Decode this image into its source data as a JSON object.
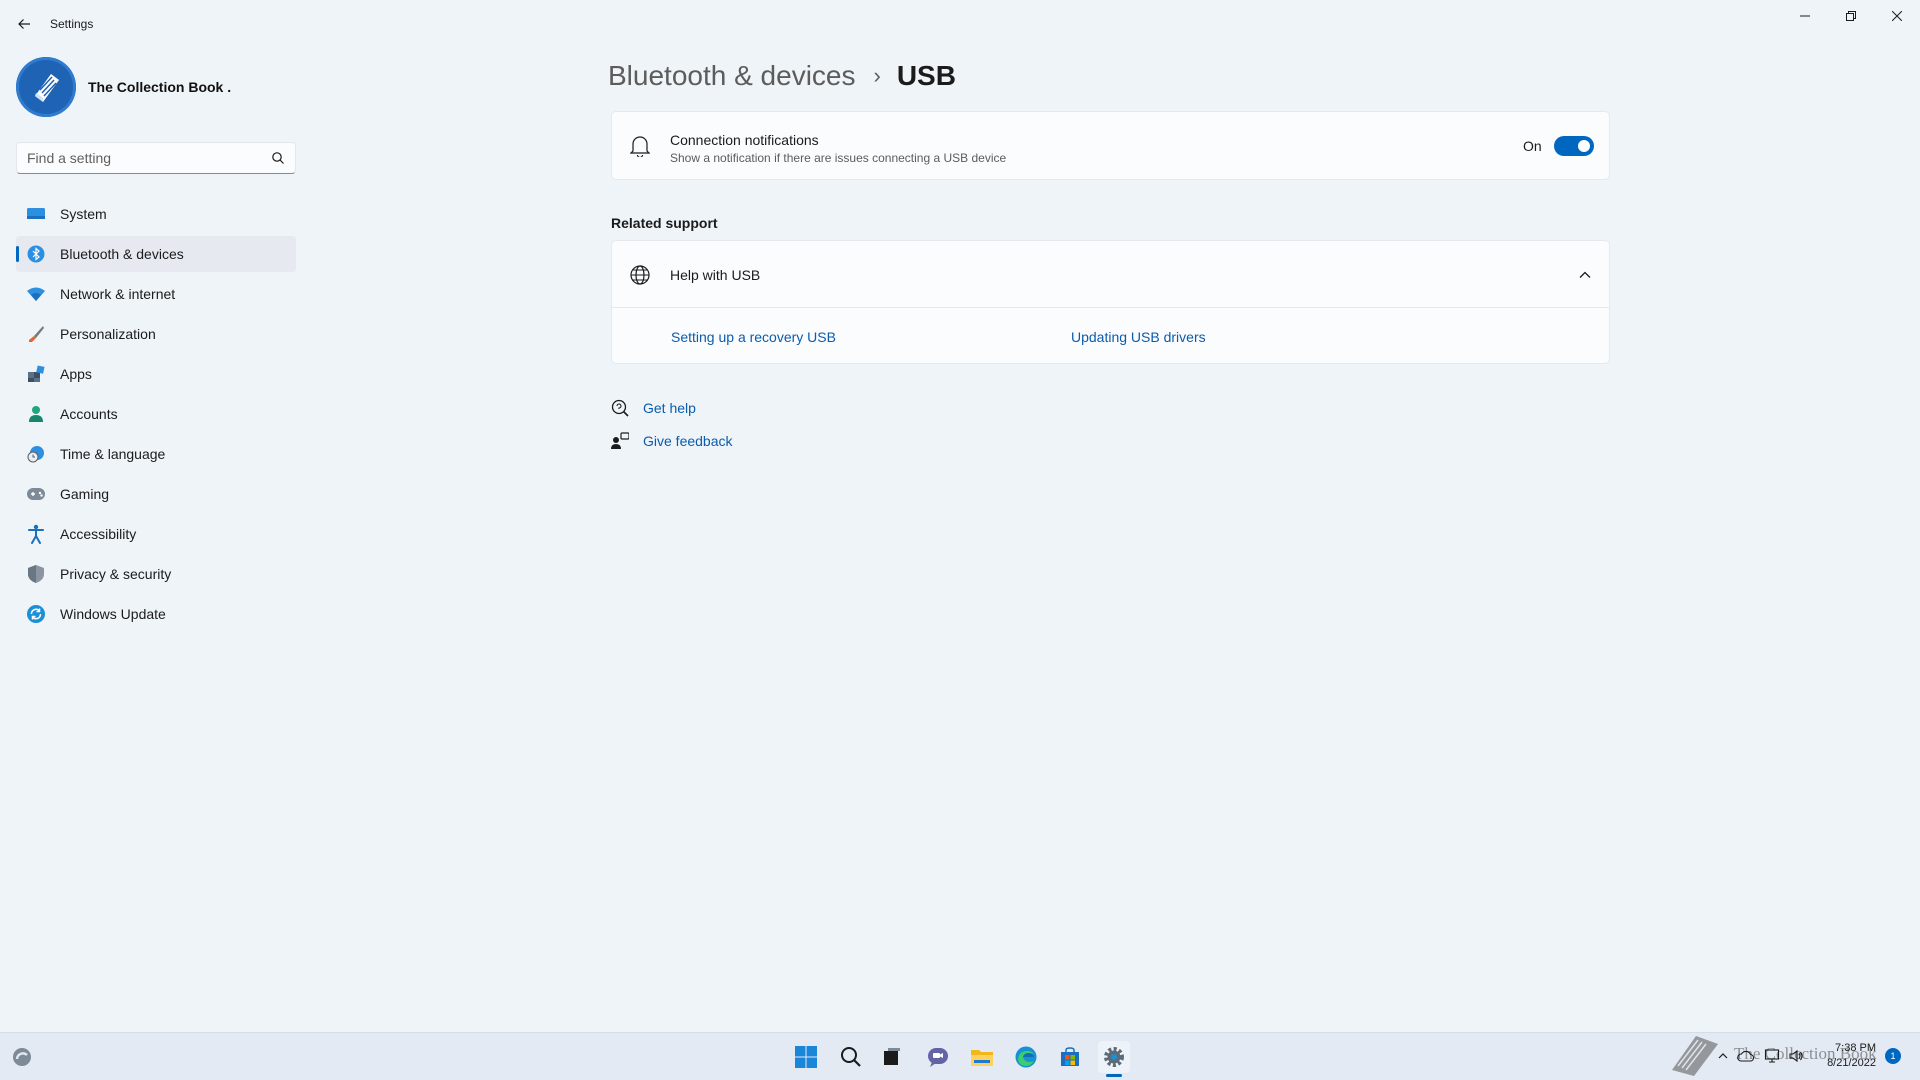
{
  "app": {
    "title": "Settings"
  },
  "profile": {
    "name": "The Collection Book ."
  },
  "search": {
    "placeholder": "Find a setting"
  },
  "sidebar": {
    "items": [
      {
        "label": "System",
        "icon": "monitor-icon"
      },
      {
        "label": "Bluetooth & devices",
        "icon": "bluetooth-icon",
        "active": true
      },
      {
        "label": "Network & internet",
        "icon": "wifi-icon"
      },
      {
        "label": "Personalization",
        "icon": "brush-icon"
      },
      {
        "label": "Apps",
        "icon": "apps-icon"
      },
      {
        "label": "Accounts",
        "icon": "person-icon"
      },
      {
        "label": "Time & language",
        "icon": "globe-clock-icon"
      },
      {
        "label": "Gaming",
        "icon": "gamepad-icon"
      },
      {
        "label": "Accessibility",
        "icon": "accessibility-icon"
      },
      {
        "label": "Privacy & security",
        "icon": "shield-icon"
      },
      {
        "label": "Windows Update",
        "icon": "update-icon"
      }
    ]
  },
  "breadcrumb": {
    "parent": "Bluetooth & devices",
    "separator": "›",
    "current": "USB"
  },
  "connection_notifications": {
    "title": "Connection notifications",
    "description": "Show a notification if there are issues connecting a USB device",
    "state_label": "On",
    "enabled": true
  },
  "related_support": {
    "heading": "Related support",
    "help_title": "Help with USB",
    "links": [
      "Setting up a recovery USB",
      "Updating USB drivers"
    ]
  },
  "footer": {
    "get_help": "Get help",
    "give_feedback": "Give feedback"
  },
  "taskbar": {
    "time": "7:38 PM",
    "date": "8/21/2022",
    "notification_count": "1",
    "watermark_text": "The Collection Book"
  },
  "colors": {
    "accent": "#0067c0",
    "link": "#0b5cad",
    "background": "#eff4f9",
    "card": "#fbfcfd"
  }
}
